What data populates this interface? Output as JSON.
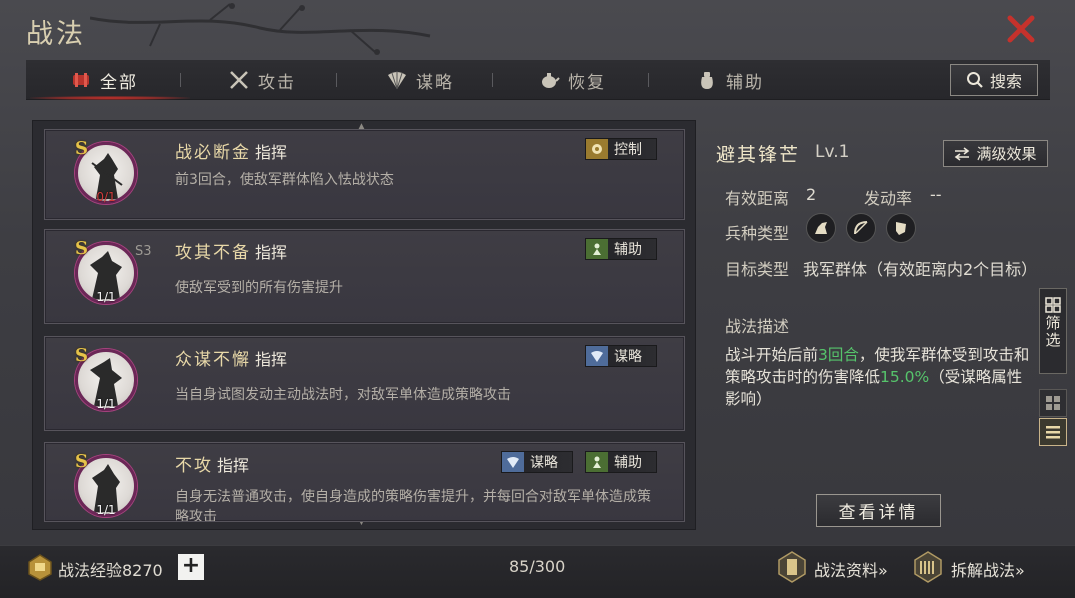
{
  "header": {
    "title": "战法"
  },
  "tabs": [
    {
      "label": "全部",
      "icon": "scroll-icon",
      "active": true
    },
    {
      "label": "攻击",
      "icon": "crossed-swords-icon",
      "active": false
    },
    {
      "label": "谋略",
      "icon": "fan-icon",
      "active": false
    },
    {
      "label": "恢复",
      "icon": "teapot-icon",
      "active": false
    },
    {
      "label": "辅助",
      "icon": "pouch-icon",
      "active": false
    }
  ],
  "search": {
    "label": "搜索"
  },
  "tactics": [
    {
      "name": "战必断金",
      "kind": "指挥",
      "grade": "S",
      "level": "",
      "count": "0/1",
      "count_red": true,
      "desc": "前3回合，使敌军群体陷入怯战状态",
      "tags": [
        {
          "label": "控制",
          "color": "gold"
        }
      ]
    },
    {
      "name": "攻其不备",
      "kind": "指挥",
      "grade": "S",
      "level": "S3",
      "count": "1/1",
      "count_red": false,
      "desc": "使敌军受到的所有伤害提升",
      "tags": [
        {
          "label": "辅助",
          "color": "green"
        }
      ]
    },
    {
      "name": "众谋不懈",
      "kind": "指挥",
      "grade": "S",
      "level": "",
      "count": "1/1",
      "count_red": false,
      "desc": "当自身试图发动主动战法时，对敌军单体造成策略攻击",
      "tags": [
        {
          "label": "谋略",
          "color": "blue"
        }
      ]
    },
    {
      "name": "不攻",
      "kind": "指挥",
      "grade": "S",
      "level": "",
      "count": "1/1",
      "count_red": false,
      "desc": "自身无法普通攻击，使自身造成的策略伤害提升，并每回合对敌军单体造成策略攻击",
      "tags": [
        {
          "label": "谋略",
          "color": "blue"
        },
        {
          "label": "辅助",
          "color": "green"
        }
      ]
    }
  ],
  "detail": {
    "name": "避其锋芒",
    "level": "Lv.1",
    "max_effect_label": "满级效果",
    "range_label": "有效距离",
    "range_value": "2",
    "rate_label": "发动率",
    "rate_value": "--",
    "troop_label": "兵种类型",
    "troops": [
      "cavalry-icon",
      "archer-icon",
      "shield-icon"
    ],
    "target_label": "目标类型",
    "target_value": "我军群体（有效距离内2个目标）",
    "desc_label": "战法描述",
    "desc_part1": "战斗开始后前",
    "desc_hl1": "3回合",
    "desc_part2": "，使我军群体受到攻击和策略攻击时的伤害降低",
    "desc_hl2": "15.0%",
    "desc_part3": "（受谋略属性影响）",
    "view_detail_label": "查看详情"
  },
  "side": {
    "filter_label": "筛选"
  },
  "footer": {
    "exp_label": "战法经验8270",
    "capacity": "85/300",
    "data_link": "战法资料»",
    "dismantle_link": "拆解战法»"
  },
  "colors": {
    "accent_red": "#c4302a",
    "highlight_green": "#56c46b",
    "gold": "#e6c34a"
  }
}
